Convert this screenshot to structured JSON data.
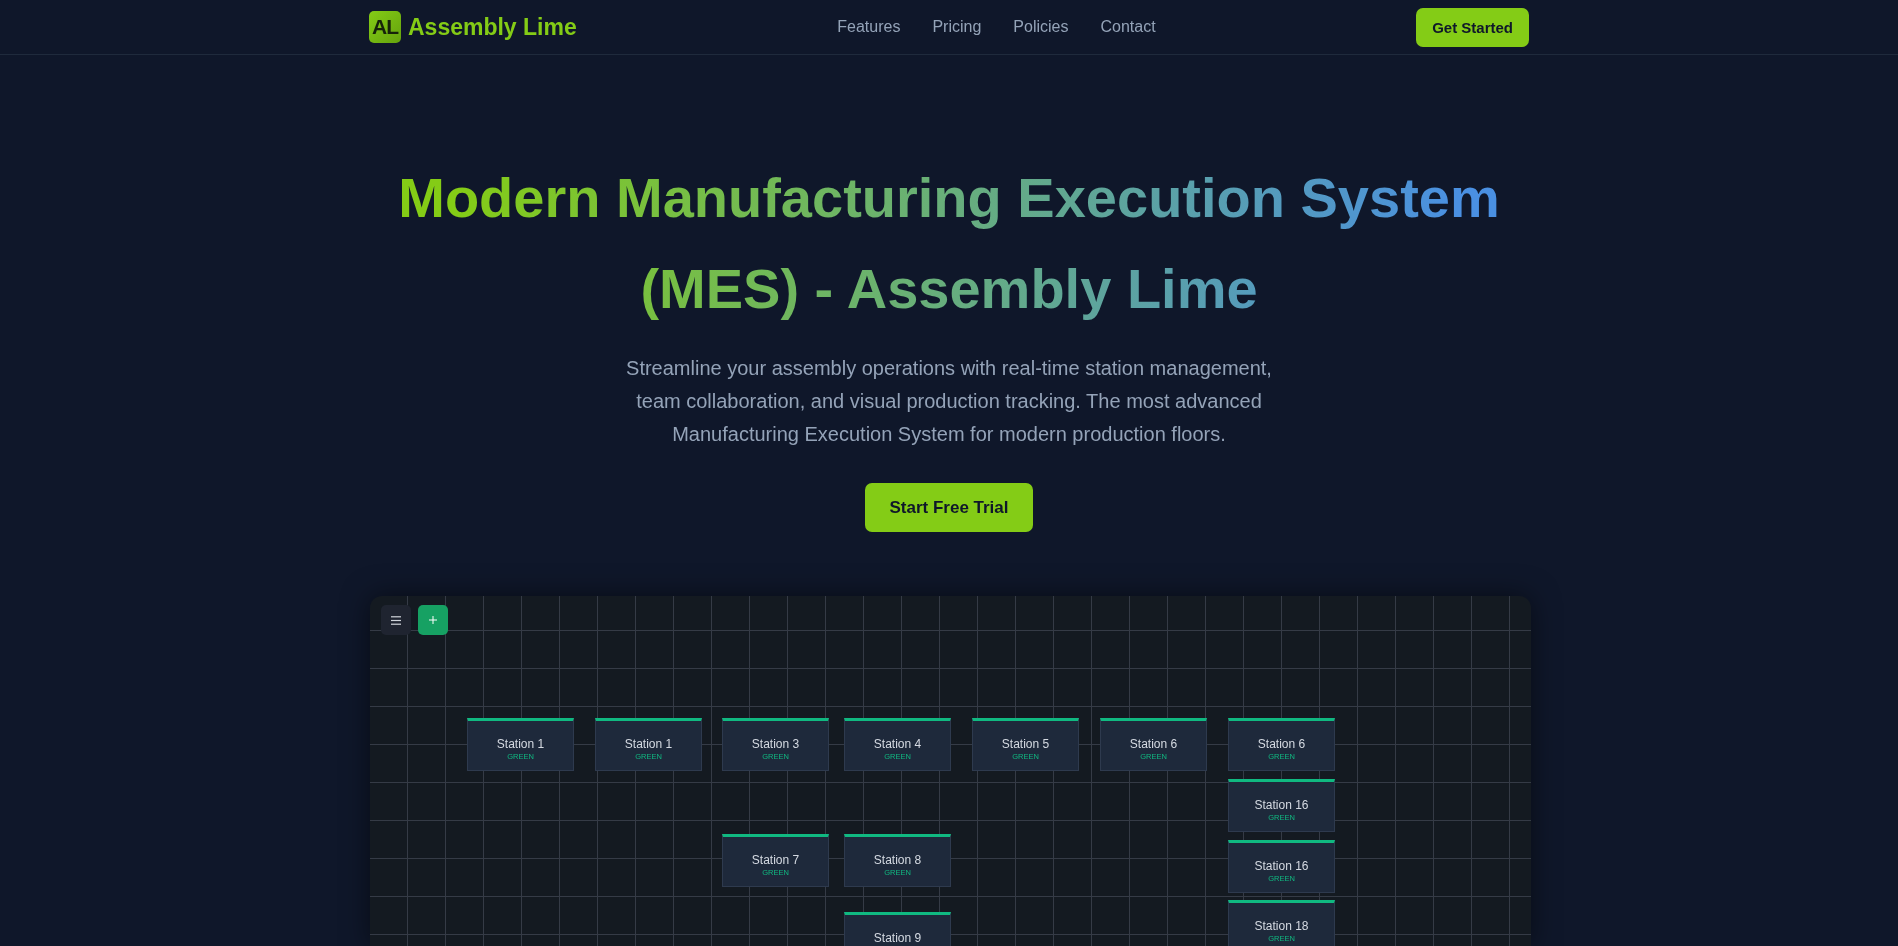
{
  "header": {
    "logo_mark": "AL",
    "brand": "Assembly Lime",
    "nav": [
      "Features",
      "Pricing",
      "Policies",
      "Contact"
    ],
    "cta": "Get Started"
  },
  "hero": {
    "title": "Modern Manufacturing Execution System (MES) - Assembly Lime",
    "subtitle": "Streamline your assembly operations with real-time station management, team collaboration, and visual production tracking. The most advanced Manufacturing Execution System for modern production floors.",
    "cta": "Start Free Trial"
  },
  "canvas": {
    "stations": [
      {
        "label": "Station 1",
        "status": "GREEN"
      },
      {
        "label": "Station 1",
        "status": "GREEN"
      },
      {
        "label": "Station 3",
        "status": "GREEN"
      },
      {
        "label": "Station 4",
        "status": "GREEN"
      },
      {
        "label": "Station 5",
        "status": "GREEN"
      },
      {
        "label": "Station 6",
        "status": "GREEN"
      },
      {
        "label": "Station 6",
        "status": "GREEN"
      },
      {
        "label": "Station 16",
        "status": "GREEN"
      },
      {
        "label": "Station 7",
        "status": "GREEN"
      },
      {
        "label": "Station 8",
        "status": "GREEN"
      },
      {
        "label": "Station 16",
        "status": "GREEN"
      },
      {
        "label": "Station 9"
      },
      {
        "label": "Station 18",
        "status": "GREEN"
      }
    ]
  }
}
